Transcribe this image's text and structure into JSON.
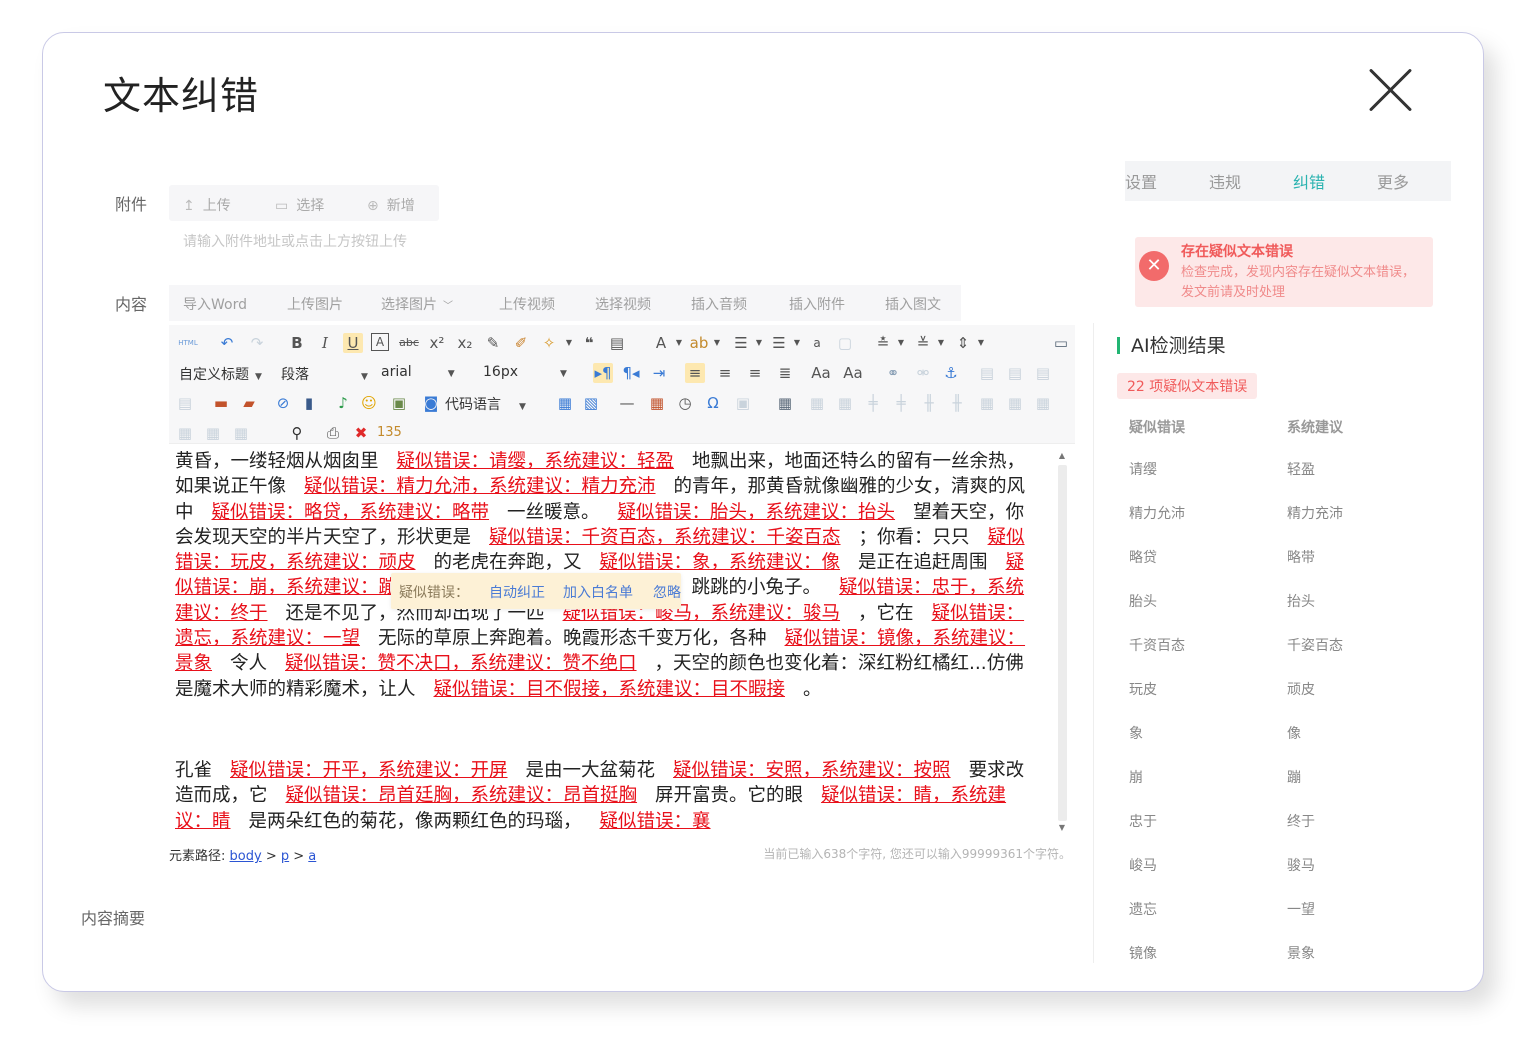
{
  "dialog": {
    "title": "文本纠错"
  },
  "form": {
    "attach_label": "附件",
    "attach_buttons": [
      "上传",
      "选择",
      "新增"
    ],
    "attach_hint": "请输入附件地址或点击上方按钮上传",
    "content_label": "内容",
    "summary_label": "内容摘要"
  },
  "media_buttons": [
    "导入Word",
    "上传图片",
    "选择图片",
    "上传视频",
    "选择视频",
    "插入音频",
    "插入附件",
    "插入图文"
  ],
  "toolbar": {
    "heading_select": "自定义标题",
    "para_select": "段落",
    "font_select": "arial",
    "size_select": "16px",
    "code_select": "代码语言",
    "html_label": "HTML"
  },
  "content": {
    "paragraphs": [
      [
        {
          "t": "黄昏，一缕轻烟从烟囱里"
        },
        {
          "e": "疑似错误：请缨，系统建议：轻盈"
        },
        {
          "t": "地飘出来，地面还特么的留有一丝余热，如果说正午像"
        },
        {
          "e": "疑似错误：精力允沛，系统建议：精力充沛"
        },
        {
          "t": "的青年，那黄昏就像幽雅的少女，清爽的风中"
        },
        {
          "e": "疑似错误：略贷，系统建议：略带"
        },
        {
          "t": "一丝暖意。"
        },
        {
          "e": "疑似错误：胎头，系统建议：抬头"
        },
        {
          "t": "望着天空，你会发现天空的半片天空了，形状更是"
        },
        {
          "e": "疑似错误：千资百态，系统建议：千姿百态"
        },
        {
          "t": "；你看："
        },
        {
          "t": "只只"
        },
        {
          "e": "疑似错误：玩皮，系统建议：顽皮"
        },
        {
          "t": "的老虎在奔跑，又"
        },
        {
          "e": "疑似错误：象，系统建议：像"
        },
        {
          "t": "是正在追赶周围"
        },
        {
          "e": "疑似错误：崩，系统建议：蹦"
        },
        {
          "e": "疑似错误：崩，系统建议：蹦"
        },
        {
          "t": "跳跳的小兔子。"
        },
        {
          "e": "疑似错误：忠于，系统建议：终于"
        },
        {
          "t": "还是不见了，然而却出现了一匹"
        },
        {
          "e": "疑似错误：峻马，系统建议：骏马"
        },
        {
          "t": "，它在"
        },
        {
          "e": "疑似错误：遗忘，系统建议：一望"
        },
        {
          "t": "无际的草原上奔跑着。晚霞形态千变万化，各种"
        },
        {
          "e": "疑似错误：镜像，系统建议：景象"
        },
        {
          "t": "令人"
        },
        {
          "e": "疑似错误：赞不决口，系统建议：赞不绝口"
        },
        {
          "t": "，天空的颜色也变化着：深红粉红橘红...仿佛是魔术大师的精彩魔术，让人"
        },
        {
          "e": "疑似错误：目不假接，系统建议：目不暇接"
        },
        {
          "t": "。"
        }
      ],
      [
        {
          "t": "孔雀"
        },
        {
          "e": "疑似错误：开平，系统建议：开屏"
        },
        {
          "t": "是由一大盆菊花"
        },
        {
          "e": "疑似错误：安照，系统建议：按照"
        },
        {
          "t": "要求改造而成，它"
        },
        {
          "e": "疑似错误：昂首廷胸，系统建议：昂首挺胸"
        },
        {
          "t": "屏开富贵。它的眼"
        },
        {
          "e": "疑似错误：睛，系统建议：睛"
        },
        {
          "t": "是两朵红色的菊花，像两颗红色的玛瑙，"
        },
        {
          "e": "疑似错误：襄"
        }
      ]
    ],
    "popup": {
      "label": "疑似错误：",
      "fix": "自动纠正",
      "whitelist": "加入白名单",
      "ignore": "忽略"
    }
  },
  "status": {
    "path_label": "元素路径:",
    "path": [
      "body",
      "p",
      "a"
    ],
    "count_text": "当前已输入638个字符, 您还可以输入99999361个字符。"
  },
  "side_tabs": [
    "设置",
    "违规",
    "纠错",
    "更多"
  ],
  "alert": {
    "title": "存在疑似文本错误",
    "desc": "检查完成，发现内容存在疑似文本错误，发文前请及时处理"
  },
  "ai": {
    "title": "AI检测结果",
    "count_badge": "22 项疑似文本错误",
    "col_error": "疑似错误",
    "col_suggest": "系统建议",
    "rows": [
      [
        "请缨",
        "轻盈"
      ],
      [
        "精力允沛",
        "精力充沛"
      ],
      [
        "略贷",
        "略带"
      ],
      [
        "胎头",
        "抬头"
      ],
      [
        "千资百态",
        "千姿百态"
      ],
      [
        "玩皮",
        "顽皮"
      ],
      [
        "象",
        "像"
      ],
      [
        "崩",
        "蹦"
      ],
      [
        "忠于",
        "终于"
      ],
      [
        "峻马",
        "骏马"
      ],
      [
        "遗忘",
        "一望"
      ],
      [
        "镜像",
        "景象"
      ]
    ]
  },
  "colors": {
    "accent": "#2bb3b0",
    "error": "#e8101a",
    "alert_bg": "#fde8e8",
    "ai_bar": "#22b573"
  }
}
